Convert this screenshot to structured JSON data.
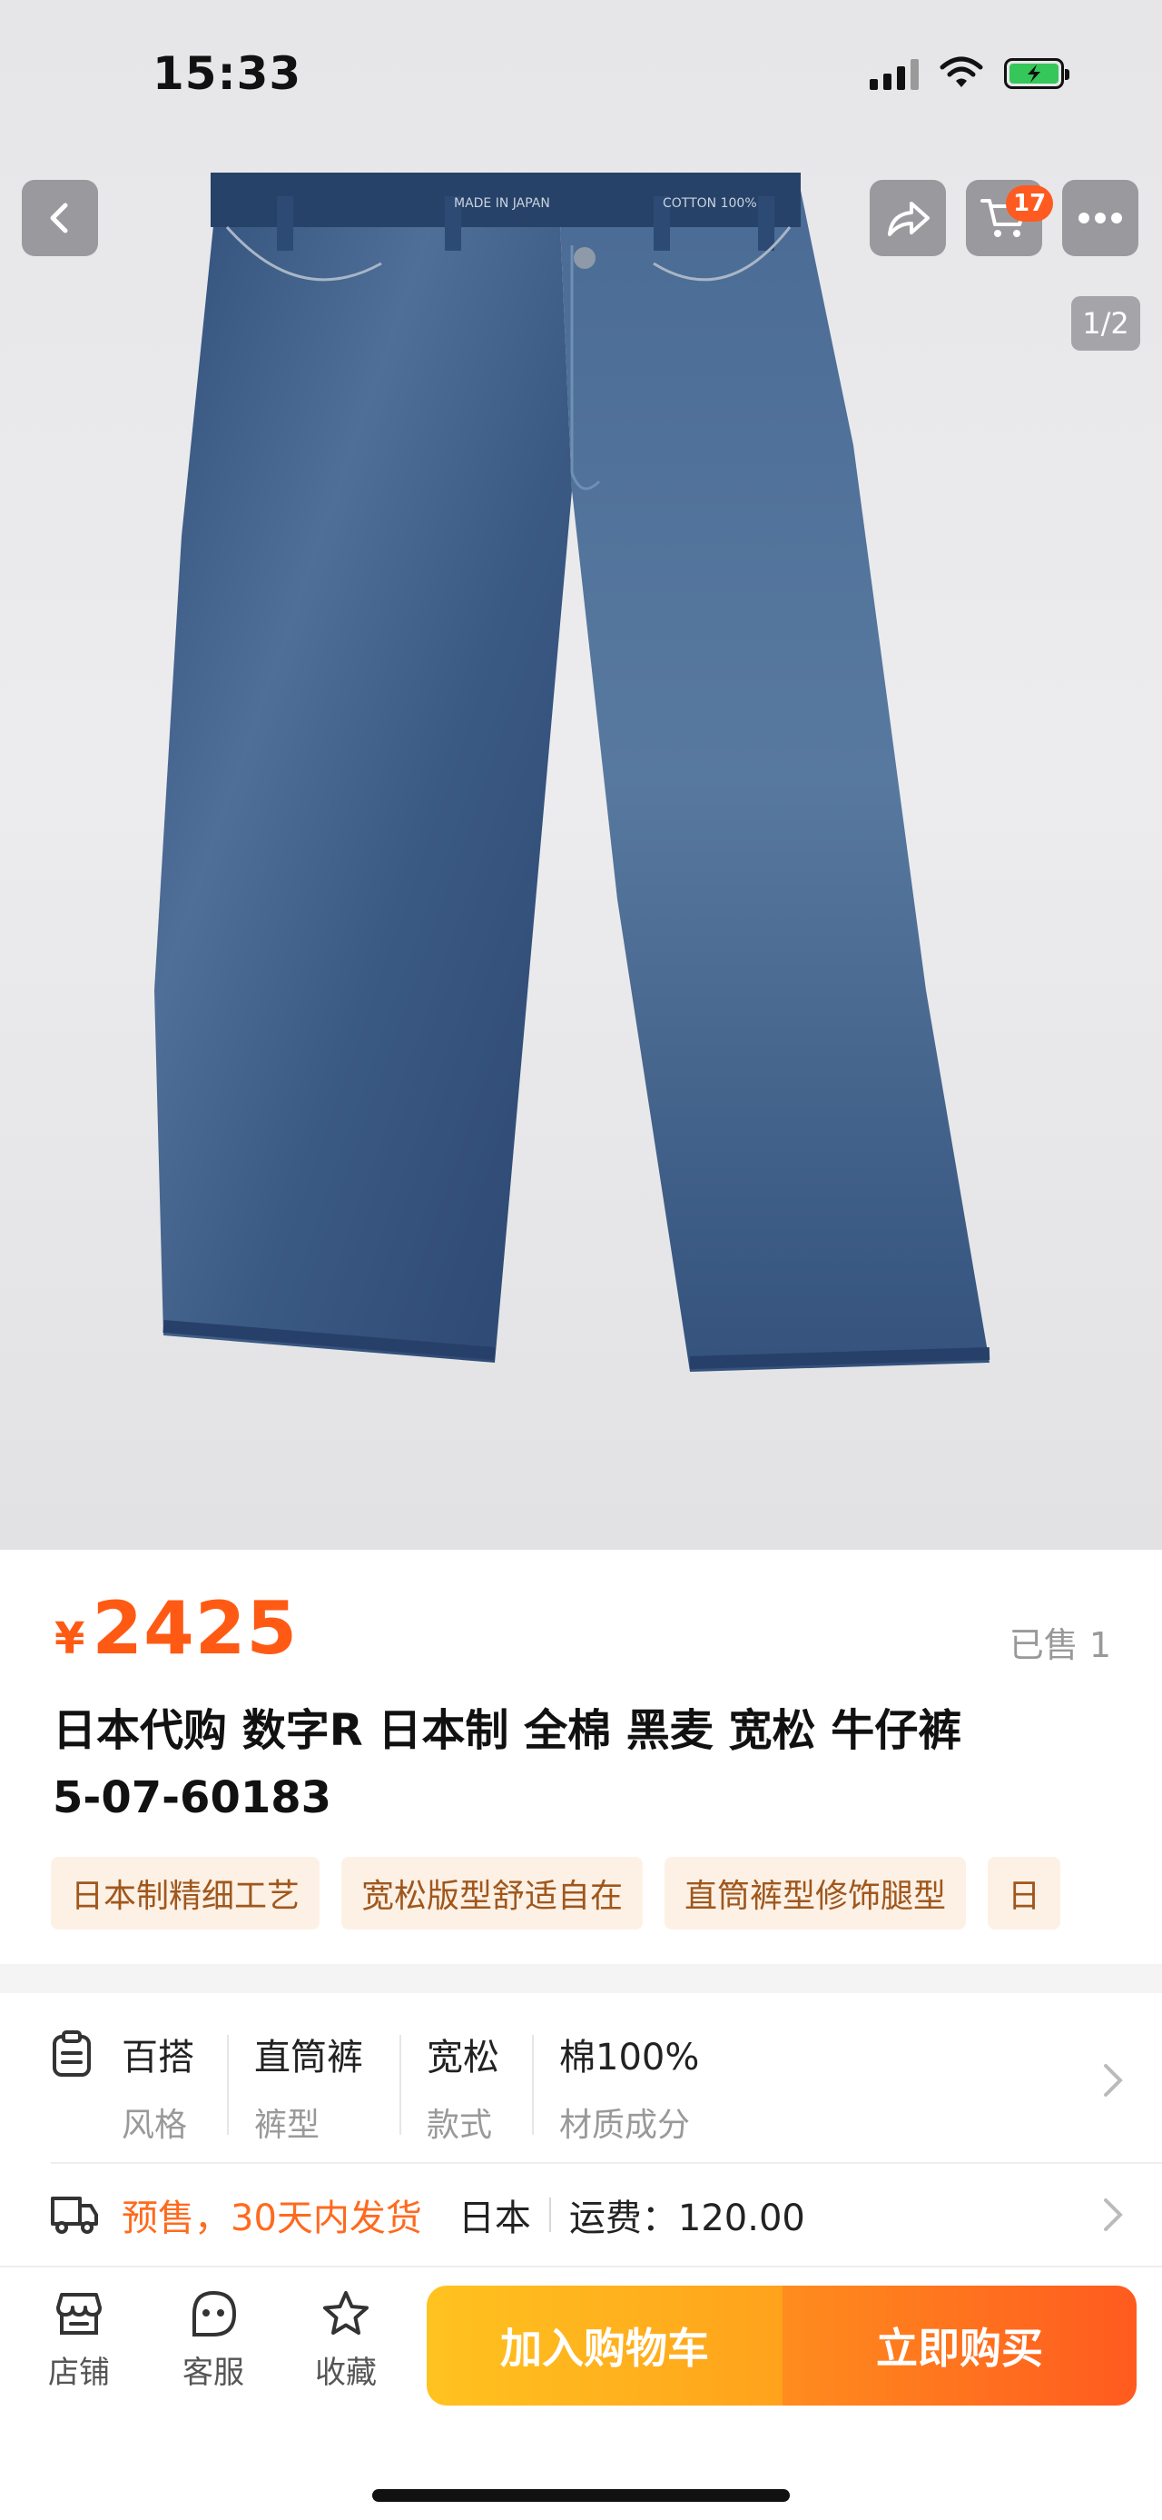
{
  "status_bar": {
    "time": "15:33"
  },
  "top_nav": {
    "cart_badge": "17",
    "image_index": "1/2"
  },
  "product": {
    "price_currency": "¥",
    "price": "2425",
    "sold": "已售 1",
    "title_line1": "日本代购 数字R 日本制 全棉 黑麦 宽松 牛仔裤",
    "title_line2": "5-07-60183",
    "tags": [
      "日本制精细工艺",
      "宽松版型舒适自在",
      "直筒裤型修饰腿型",
      "日"
    ],
    "waistband_label_left": "MADE IN JAPAN",
    "waistband_label_right": "COTTON 100%"
  },
  "attributes": [
    {
      "value": "百搭",
      "key": "风格"
    },
    {
      "value": "直筒裤",
      "key": "裤型"
    },
    {
      "value": "宽松",
      "key": "款式"
    },
    {
      "value": "棉100%",
      "key": "材质成分"
    }
  ],
  "shipping": {
    "presale": "预售，30天内发货",
    "origin": "日本",
    "fee": "运费：120.00"
  },
  "bottom_bar": {
    "store": "店铺",
    "service": "客服",
    "favorite": "收藏",
    "add_to_cart": "加入购物车",
    "buy_now": "立即购买"
  },
  "colors": {
    "accent": "#ff5a14",
    "tag_bg": "#fdf1e6",
    "tag_text": "#a0571c",
    "cart_button": "#ffb41e",
    "buy_button": "#ff5a1f"
  }
}
